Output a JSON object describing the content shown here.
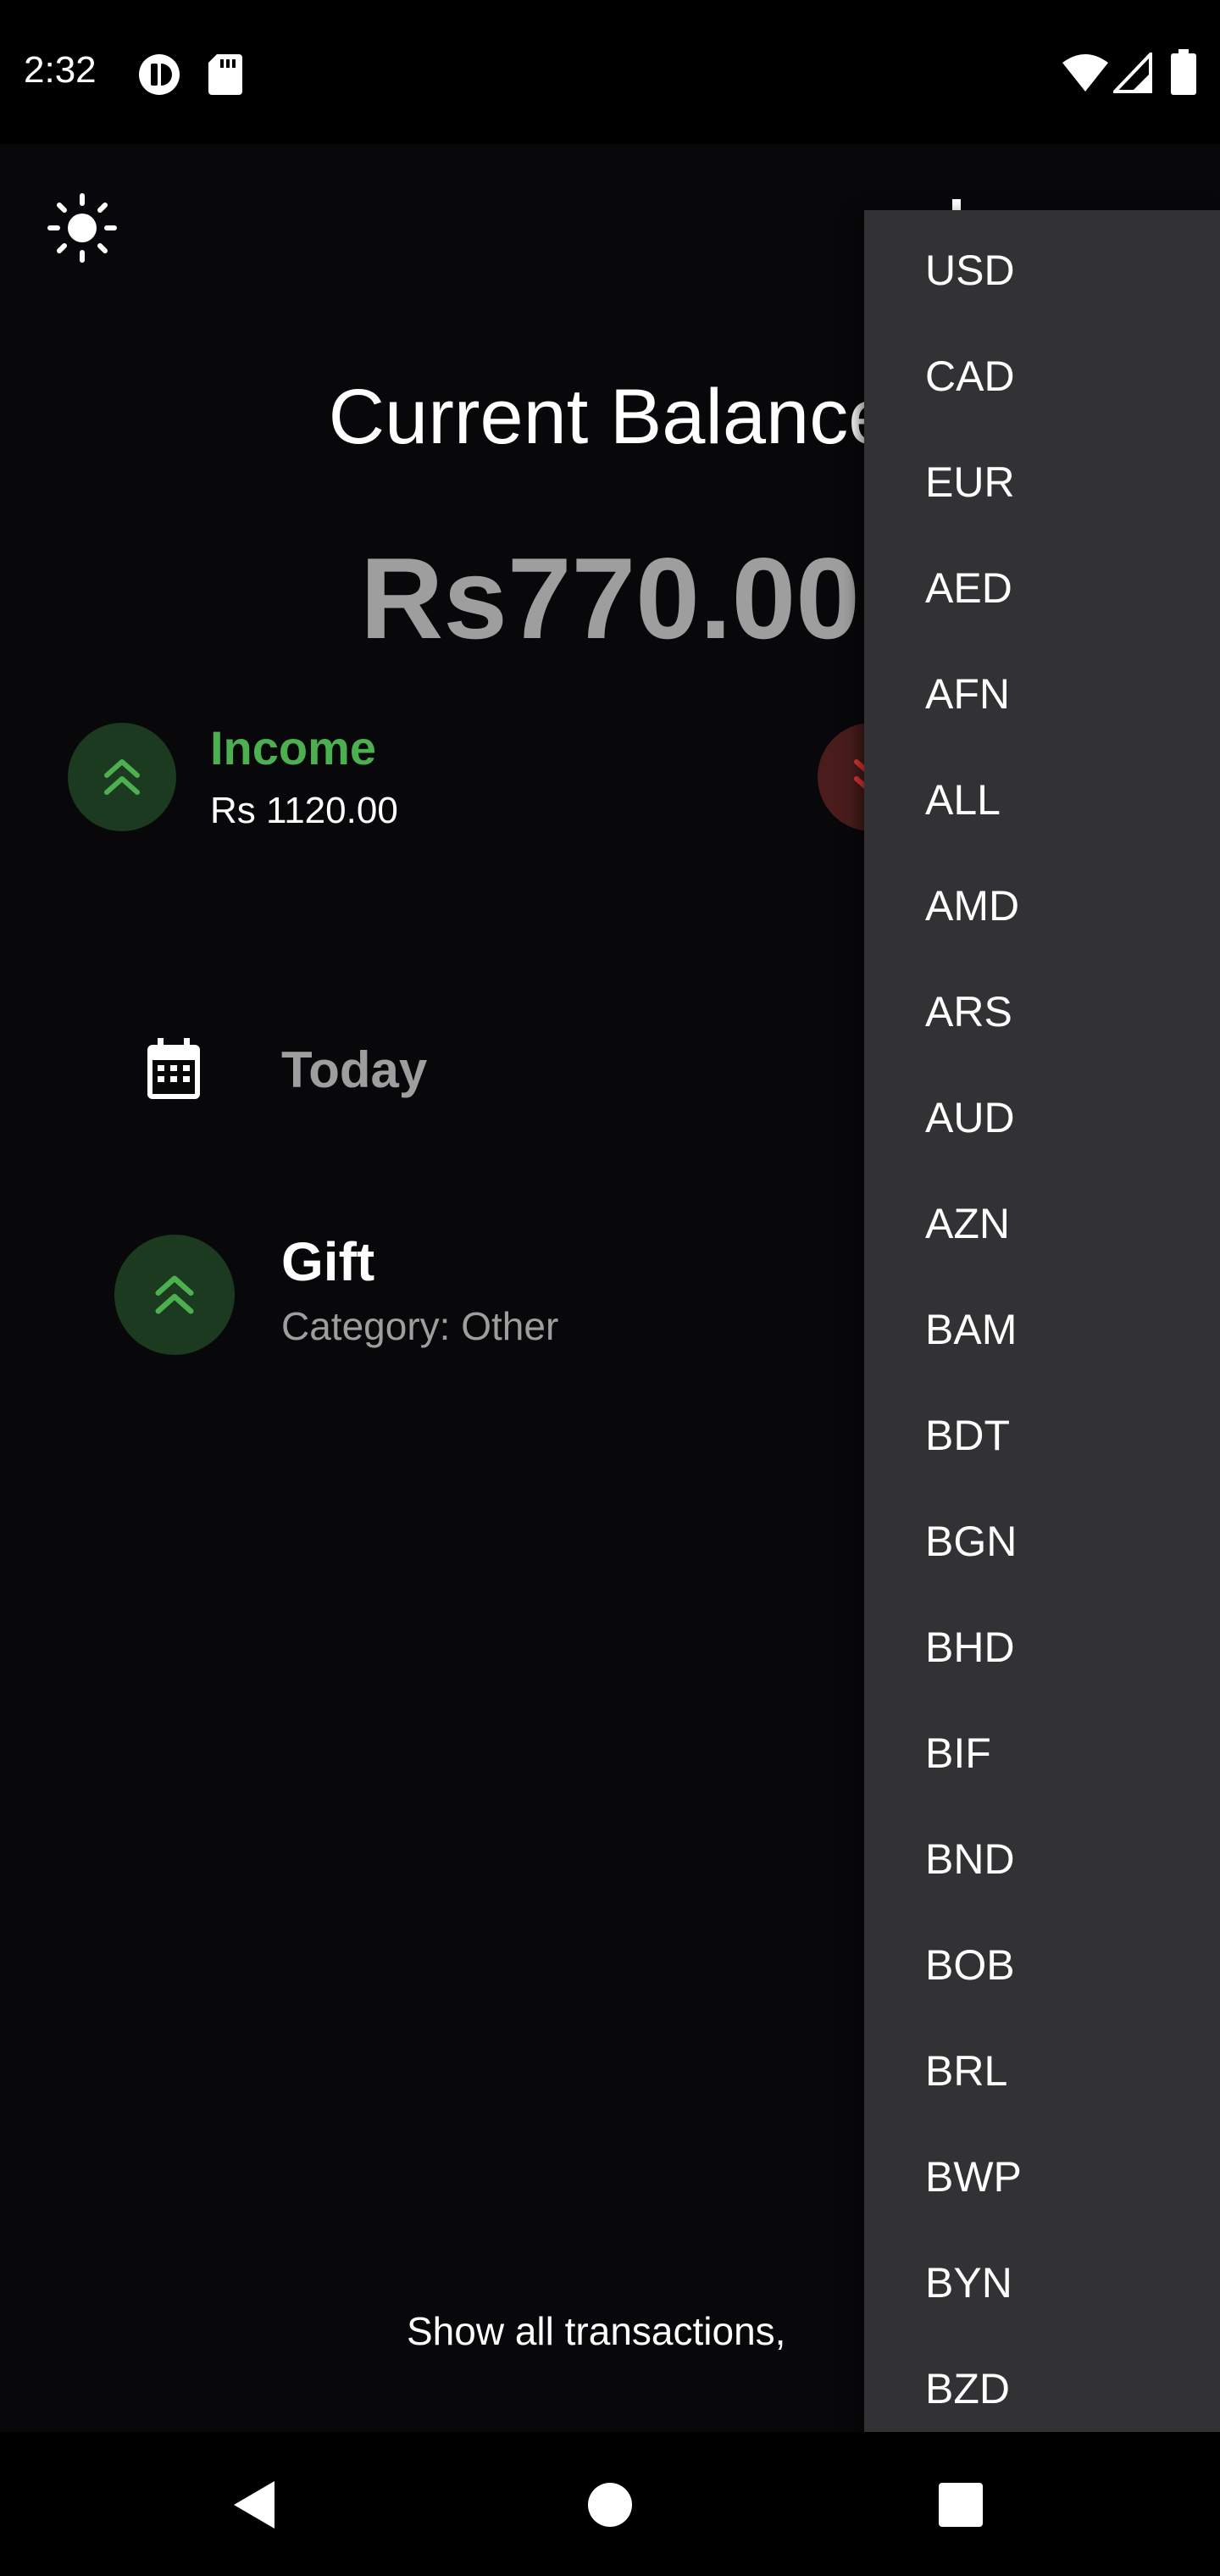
{
  "status_bar": {
    "time": "2:32",
    "left_icons": [
      "app-notification-icon",
      "sd-card-icon"
    ],
    "right_icons": [
      "wifi-icon",
      "cell-signal-icon",
      "battery-icon"
    ]
  },
  "header": {
    "theme_toggle_icon": "sun-icon"
  },
  "balance": {
    "title": "Current Balance",
    "amount": "Rs770.00"
  },
  "income": {
    "label": "Income",
    "amount": "Rs 1120.00",
    "color": "#4caf50"
  },
  "expense": {
    "color": "#e53935"
  },
  "transactions": {
    "date_header": "Today",
    "items": [
      {
        "title": "Gift",
        "category": "Category: Other",
        "type": "income"
      }
    ],
    "show_all_label": "Show all transactions,"
  },
  "currency_dropdown": {
    "options": [
      "USD",
      "CAD",
      "EUR",
      "AED",
      "AFN",
      "ALL",
      "AMD",
      "ARS",
      "AUD",
      "AZN",
      "BAM",
      "BDT",
      "BGN",
      "BHD",
      "BIF",
      "BND",
      "BOB",
      "BRL",
      "BWP",
      "BYN",
      "BZD"
    ]
  },
  "nav_bar": {
    "icons": [
      "back-icon",
      "home-icon",
      "recents-icon"
    ]
  }
}
